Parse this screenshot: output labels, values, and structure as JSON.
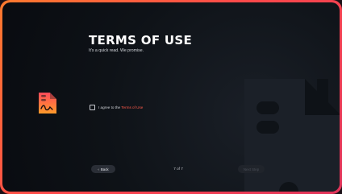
{
  "header": {
    "title": "TERMS OF USE",
    "subtitle": "It's a quick read. We promise."
  },
  "agreement": {
    "checked": false,
    "prefix": "I agree to the ",
    "link_text": "Terms of Use"
  },
  "footer": {
    "back_icon": "‹",
    "back_label": "Back",
    "page_indicator": "7 of 7",
    "next_label": "Next Step"
  },
  "icons": {
    "document": "document-signature-icon",
    "background": "document-watermark-icon"
  },
  "colors": {
    "accent": "#ff5a4a",
    "frame_start": "#ff7a2e",
    "frame_end": "#e0335a",
    "background": "#0e1217"
  }
}
